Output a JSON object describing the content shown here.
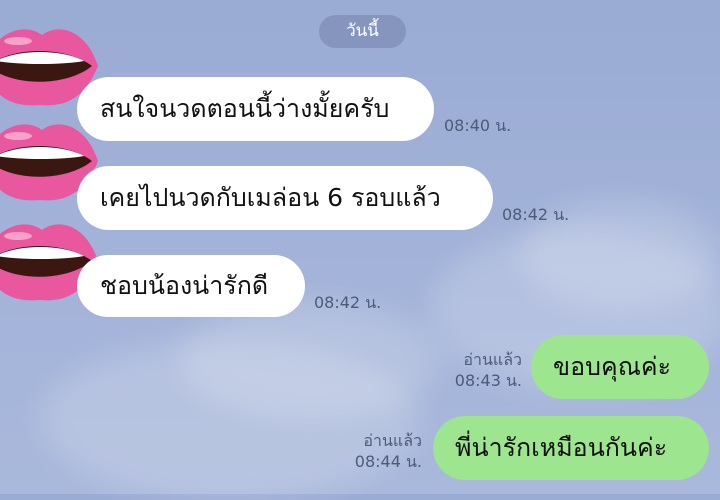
{
  "date_divider": "วันนี้",
  "messages": [
    {
      "text": "สนใจนวดตอนนี้ว่างมั้ยครับ",
      "time": "08:40 น."
    },
    {
      "text": "เคยไปนวดกับเมล่อน 6 รอบแล้ว",
      "time": "08:42 น."
    },
    {
      "text": "ชอบน้องน่ารักดี",
      "time": "08:42 น."
    },
    {
      "text": "ขอบคุณค่ะ",
      "status": "อ่านแล้ว",
      "time": "08:43 น."
    },
    {
      "text": "พี่น่ารักเหมือนกันค่ะ",
      "status": "อ่านแล้ว",
      "time": "08:44 น."
    }
  ],
  "colors": {
    "incoming_bubble": "#ffffff",
    "outgoing_bubble": "#9de58f",
    "background": "#9aabd4",
    "avatar": "#e9579e"
  },
  "icons": [
    "lips-avatar-icon"
  ]
}
